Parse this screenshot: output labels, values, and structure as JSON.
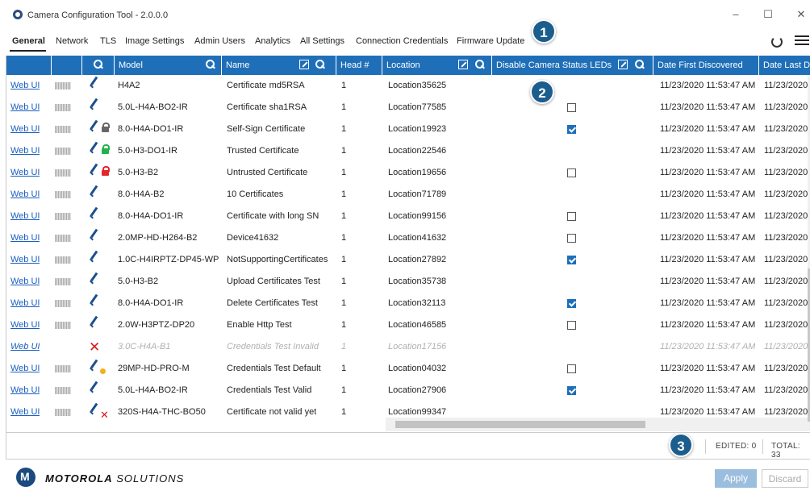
{
  "window": {
    "title": "Camera Configuration Tool - 2.0.0.0",
    "minimize": "–",
    "maximize": "☐",
    "close": "✕"
  },
  "tabs": [
    "General",
    "Network",
    "TLS",
    "Image Settings",
    "Admin Users",
    "Analytics",
    "All Settings",
    "Connection Credentials",
    "Firmware Update"
  ],
  "badges": [
    "1",
    "2",
    "3"
  ],
  "columns": {
    "model": "Model",
    "name": "Name",
    "head": "Head #",
    "location": "Location",
    "leds": "Disable Camera Status LEDs",
    "first": "Date First Discovered",
    "last": "Date Last D"
  },
  "rows": [
    {
      "link": "Web UI",
      "model": "H4A2",
      "name": "Certificate md5RSA",
      "head": "1",
      "location": "Location35625",
      "first": "11/23/2020 11:53:47 AM",
      "last": "11/23/2020"
    },
    {
      "link": "Web UI",
      "model": "5.0L-H4A-BO2-IR",
      "name": "Certificate sha1RSA",
      "head": "1",
      "location": "Location77585",
      "first": "11/23/2020 11:53:47 AM",
      "last": "11/23/2020"
    },
    {
      "link": "Web UI",
      "model": "8.0-H4A-DO1-IR",
      "name": "Self-Sign Certificate",
      "head": "1",
      "location": "Location19923",
      "first": "11/23/2020 11:53:47 AM",
      "last": "11/23/2020"
    },
    {
      "link": "Web UI",
      "model": "5.0-H3-DO1-IR",
      "name": "Trusted Certificate",
      "head": "1",
      "location": "Location22546",
      "first": "11/23/2020 11:53:47 AM",
      "last": "11/23/2020"
    },
    {
      "link": "Web UI",
      "model": "5.0-H3-B2",
      "name": "Untrusted Certificate",
      "head": "1",
      "location": "Location19656",
      "first": "11/23/2020 11:53:47 AM",
      "last": "11/23/2020"
    },
    {
      "link": "Web UI",
      "model": "8.0-H4A-B2",
      "name": "10 Certificates",
      "head": "1",
      "location": "Location71789",
      "first": "11/23/2020 11:53:47 AM",
      "last": "11/23/2020"
    },
    {
      "link": "Web UI",
      "model": "8.0-H4A-DO1-IR",
      "name": "Certificate with long SN",
      "head": "1",
      "location": "Location99156",
      "first": "11/23/2020 11:53:47 AM",
      "last": "11/23/2020"
    },
    {
      "link": "Web UI",
      "model": "2.0MP-HD-H264-B2",
      "name": "Device41632",
      "head": "1",
      "location": "Location41632",
      "first": "11/23/2020 11:53:47 AM",
      "last": "11/23/2020"
    },
    {
      "link": "Web UI",
      "model": "1.0C-H4IRPTZ-DP45-WP",
      "name": "NotSupportingCertificates",
      "head": "1",
      "location": "Location27892",
      "first": "11/23/2020 11:53:47 AM",
      "last": "11/23/2020"
    },
    {
      "link": "Web UI",
      "model": "5.0-H3-B2",
      "name": "Upload Certificates Test",
      "head": "1",
      "location": "Location35738",
      "first": "11/23/2020 11:53:47 AM",
      "last": "11/23/2020"
    },
    {
      "link": "Web UI",
      "model": "8.0-H4A-DO1-IR",
      "name": "Delete Certificates Test",
      "head": "1",
      "location": "Location32113",
      "first": "11/23/2020 11:53:47 AM",
      "last": "11/23/2020"
    },
    {
      "link": "Web UI",
      "model": "2.0W-H3PTZ-DP20",
      "name": "Enable Http Test",
      "head": "1",
      "location": "Location46585",
      "first": "11/23/2020 11:53:47 AM",
      "last": "11/23/2020"
    },
    {
      "link": "Web UI",
      "model": "3.0C-H4A-B1",
      "name": "Credentials Test Invalid",
      "head": "1",
      "location": "Location17156",
      "first": "11/23/2020 11:53:47 AM",
      "last": "11/23/2020"
    },
    {
      "link": "Web UI",
      "model": "29MP-HD-PRO-M",
      "name": "Credentials Test Default",
      "head": "1",
      "location": "Location04032",
      "first": "11/23/2020 11:53:47 AM",
      "last": "11/23/2020"
    },
    {
      "link": "Web UI",
      "model": "5.0L-H4A-BO2-IR",
      "name": "Credentials Test Valid",
      "head": "1",
      "location": "Location27906",
      "first": "11/23/2020 11:53:47 AM",
      "last": "11/23/2020"
    },
    {
      "link": "Web UI",
      "model": "320S-H4A-THC-BO50",
      "name": "Certificate not valid yet",
      "head": "1",
      "location": "Location99347",
      "first": "11/23/2020 11:53:47 AM",
      "last": "11/23/2020"
    }
  ],
  "status": {
    "edited": "EDITED: 0",
    "total": "TOTAL: 33"
  },
  "footer": {
    "brand_bold": "MOTOROLA",
    "brand_rest": " SOLUTIONS",
    "apply": "Apply",
    "discard": "Discard"
  }
}
